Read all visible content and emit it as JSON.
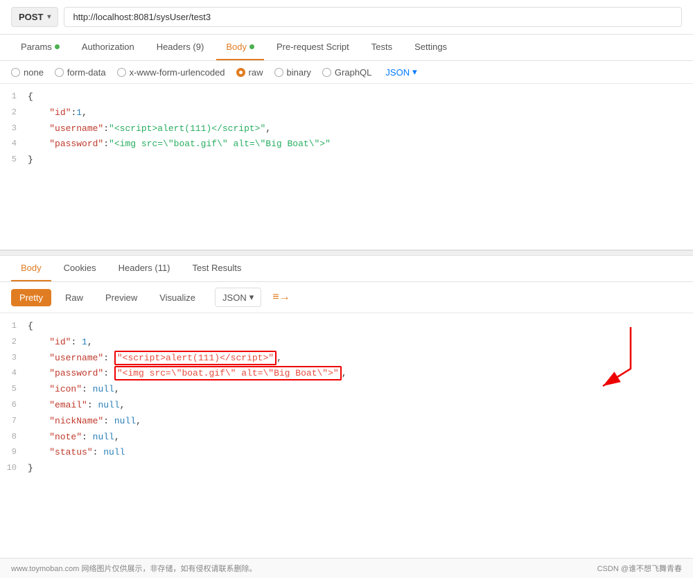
{
  "urlBar": {
    "method": "POST",
    "url": "http://localhost:8081/sysUser/test3",
    "chevron": "▾"
  },
  "tabs": [
    {
      "id": "params",
      "label": "Params",
      "dot": "green",
      "active": false
    },
    {
      "id": "authorization",
      "label": "Authorization",
      "dot": null,
      "active": false
    },
    {
      "id": "headers",
      "label": "Headers (9)",
      "dot": null,
      "active": false
    },
    {
      "id": "body",
      "label": "Body",
      "dot": "green",
      "active": true
    },
    {
      "id": "prerequest",
      "label": "Pre-request Script",
      "dot": null,
      "active": false
    },
    {
      "id": "tests",
      "label": "Tests",
      "dot": null,
      "active": false
    },
    {
      "id": "settings",
      "label": "Settings",
      "dot": null,
      "active": false
    }
  ],
  "bodyOptions": [
    {
      "id": "none",
      "label": "none",
      "selected": false
    },
    {
      "id": "form-data",
      "label": "form-data",
      "selected": false
    },
    {
      "id": "urlencoded",
      "label": "x-www-form-urlencoded",
      "selected": false
    },
    {
      "id": "raw",
      "label": "raw",
      "selected": true
    },
    {
      "id": "binary",
      "label": "binary",
      "selected": false
    },
    {
      "id": "graphql",
      "label": "GraphQL",
      "selected": false
    }
  ],
  "jsonLabel": "JSON",
  "requestCode": [
    {
      "num": "1",
      "content": "{"
    },
    {
      "num": "2",
      "content": "    \"id\":1,"
    },
    {
      "num": "3",
      "content": "    \"username\":\"<script>alert(111)<\\/script>\","
    },
    {
      "num": "4",
      "content": "    \"password\":\"<img src=\\\"boat.gif\\\" alt=\\\"Big Boat\\\">\""
    },
    {
      "num": "5",
      "content": "}"
    }
  ],
  "responseTabs": [
    {
      "id": "body",
      "label": "Body",
      "active": true
    },
    {
      "id": "cookies",
      "label": "Cookies",
      "active": false
    },
    {
      "id": "headers",
      "label": "Headers (11)",
      "active": false
    },
    {
      "id": "testresults",
      "label": "Test Results",
      "active": false
    }
  ],
  "responseFormats": [
    {
      "id": "pretty",
      "label": "Pretty",
      "active": true
    },
    {
      "id": "raw",
      "label": "Raw",
      "active": false
    },
    {
      "id": "preview",
      "label": "Preview",
      "active": false
    },
    {
      "id": "visualize",
      "label": "Visualize",
      "active": false
    }
  ],
  "responseJsonLabel": "JSON",
  "responseCode": [
    {
      "num": "1",
      "content": "{"
    },
    {
      "num": "2",
      "key": "\"id\"",
      "sep": ": ",
      "value": "1",
      "valueType": "num",
      "comma": ","
    },
    {
      "num": "3",
      "key": "\"username\"",
      "sep": ": ",
      "value": "\"<script>alert(111)<\\/script>\"",
      "valueType": "xss",
      "comma": ","
    },
    {
      "num": "4",
      "key": "\"password\"",
      "sep": ": ",
      "value": "\"<img src=\\\"boat.gif\\\" alt=\\\"Big Boat\\\">\"",
      "valueType": "xss",
      "comma": ","
    },
    {
      "num": "5",
      "key": "\"icon\"",
      "sep": ": ",
      "value": "null",
      "valueType": "null",
      "comma": ","
    },
    {
      "num": "6",
      "key": "\"email\"",
      "sep": ": ",
      "value": "null",
      "valueType": "null",
      "comma": ","
    },
    {
      "num": "7",
      "key": "\"nickName\"",
      "sep": ": ",
      "value": "null",
      "valueType": "null",
      "comma": ","
    },
    {
      "num": "8",
      "key": "\"note\"",
      "sep": ": ",
      "value": "null",
      "valueType": "null",
      "comma": ","
    },
    {
      "num": "9",
      "key": "\"status\"",
      "sep": ": ",
      "value": "null",
      "valueType": "null",
      "comma": ""
    },
    {
      "num": "10",
      "content": "}"
    }
  ],
  "footer": {
    "left": "www.toymoban.com 网络图片仅供展示，非存储，如有侵权请联系删除。",
    "right": "CSDN @谁不想飞舞青春"
  }
}
